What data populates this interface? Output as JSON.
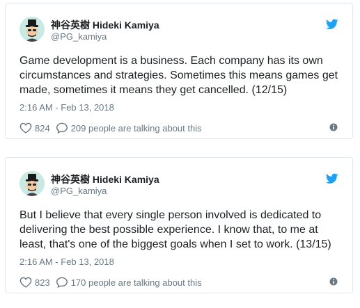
{
  "colors": {
    "twitter_blue": "#1da1f2",
    "text": "#1c2022",
    "secondary": "#697882",
    "border": "#e1e8ed"
  },
  "icons": {
    "brand": "twitter-bird-icon",
    "like": "heart-icon",
    "reply": "speech-bubble-icon",
    "info": "info-icon"
  },
  "tweets": [
    {
      "author": {
        "name": "神谷英樹 Hideki Kamiya",
        "handle": "@PG_kamiya"
      },
      "text": "Game development is a business. Each company has its own circumstances and strategies. Sometimes this means games get made, sometimes it means they get cancelled. (12/15)",
      "timestamp": "2:16 AM - Feb 13, 2018",
      "likes": "824",
      "talking": "209 people are talking about this"
    },
    {
      "author": {
        "name": "神谷英樹 Hideki Kamiya",
        "handle": "@PG_kamiya"
      },
      "text": "But I believe that every single person involved is dedicated to delivering the best possible experience. I know that, to me at least, that's one of the biggest goals when I set to work. (13/15)",
      "timestamp": "2:16 AM - Feb 13, 2018",
      "likes": "823",
      "talking": "170 people are talking about this"
    }
  ]
}
